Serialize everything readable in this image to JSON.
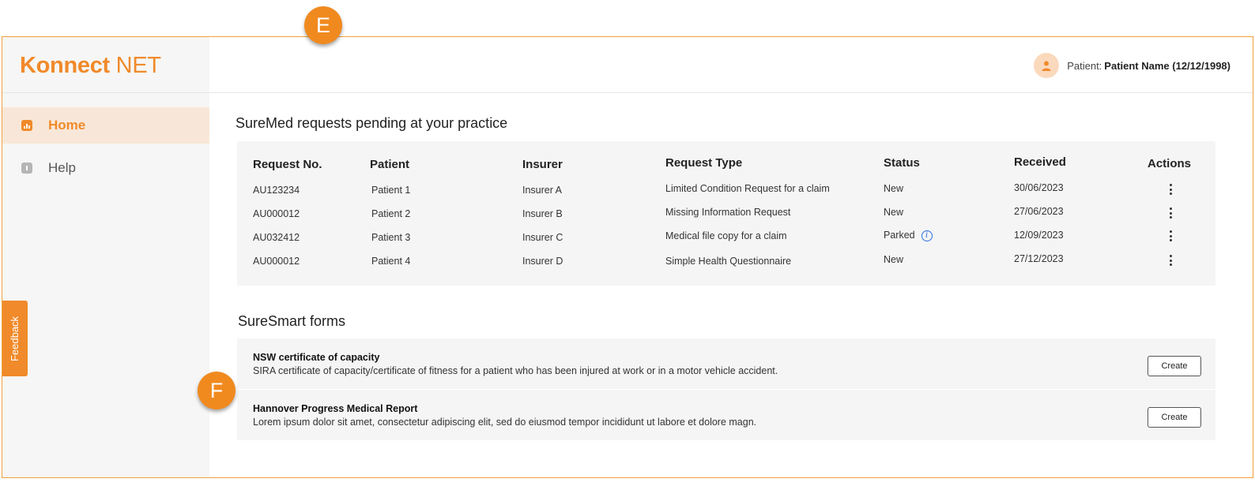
{
  "markers": {
    "e": "E",
    "f": "F"
  },
  "app": {
    "logo_bold": "Konnect",
    "logo_light": "NET"
  },
  "sidebar": {
    "items": [
      {
        "label": "Home",
        "icon": "bar-chart-icon",
        "active": true
      },
      {
        "label": "Help",
        "icon": "info-square-icon",
        "active": false
      }
    ],
    "feedback_label": "Feedback"
  },
  "header": {
    "patient_label": "Patient:",
    "patient_name": "Patient Name (12/12/1998)"
  },
  "requests": {
    "title": "SureMed requests pending at your practice",
    "columns": [
      "Request No.",
      "Patient",
      "Insurer",
      "Request Type",
      "Status",
      "Received",
      "Actions"
    ],
    "rows": [
      {
        "request_no": "AU123234",
        "patient": "Patient 1",
        "insurer": "Insurer A",
        "request_type": "Limited Condition Request for a claim",
        "status": "New",
        "received": "30/06/2023"
      },
      {
        "request_no": "AU000012",
        "patient": "Patient 2",
        "insurer": "Insurer B",
        "request_type": "Missing Information Request",
        "status": "New",
        "received": "27/06/2023"
      },
      {
        "request_no": "AU032412",
        "patient": "Patient 3",
        "insurer": "Insurer C",
        "request_type": "Medical file copy for a claim",
        "status": "Parked",
        "received": "12/09/2023"
      },
      {
        "request_no": "AU000012",
        "patient": "Patient 4",
        "insurer": "Insurer D",
        "request_type": "Simple Health Questionnaire",
        "status": "New",
        "received": "27/12/2023"
      }
    ]
  },
  "forms": {
    "title": "SureSmart forms",
    "items": [
      {
        "name": "NSW certificate of capacity",
        "description": "SIRA certificate of capacity/certificate of fitness for a patient who has been injured at work or in a motor vehicle accident.",
        "button": "Create"
      },
      {
        "name": "Hannover Progress Medical Report",
        "description": "Lorem ipsum dolor sit amet, consectetur adipiscing elit, sed do eiusmod tempor incididunt ut labore et dolore magn.",
        "button": "Create"
      }
    ]
  },
  "colors": {
    "accent": "#f08a2a",
    "border": "#f0a13c",
    "active_nav_bg": "#f8e7d8",
    "info_blue": "#2f6fe0"
  }
}
